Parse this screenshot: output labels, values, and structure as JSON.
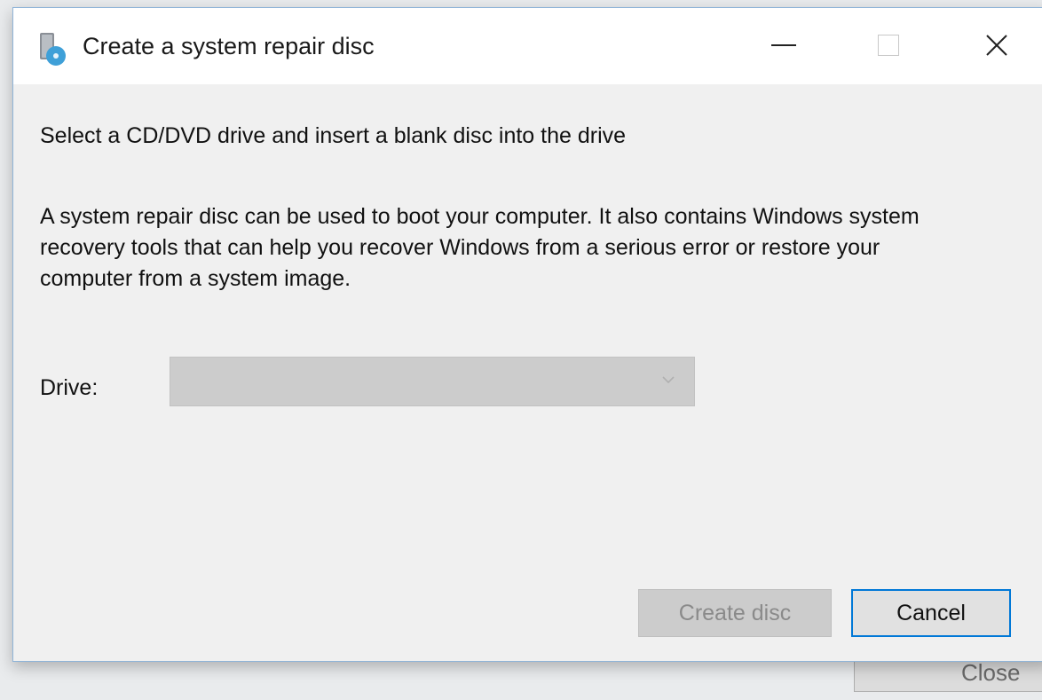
{
  "window": {
    "title": "Create a system repair disc",
    "controls": {
      "minimize_icon": "minimize-icon",
      "maximize_icon": "maximize-icon",
      "close_icon": "close-icon",
      "close_glyph": "✕"
    }
  },
  "content": {
    "heading": "Select a CD/DVD drive and insert a blank disc into the drive",
    "description": "A system repair disc can be used to boot your computer. It also contains Windows system recovery tools that can help you recover Windows from a serious error or restore your computer from a system image.",
    "drive_label": "Drive:",
    "drive_value": ""
  },
  "buttons": {
    "create_label": "Create disc",
    "cancel_label": "Cancel"
  },
  "background_window": {
    "button_label": "Close"
  },
  "colors": {
    "accent": "#0078d7",
    "dialog_bg": "#f0f0f0",
    "disabled_bg": "#cccccc"
  }
}
